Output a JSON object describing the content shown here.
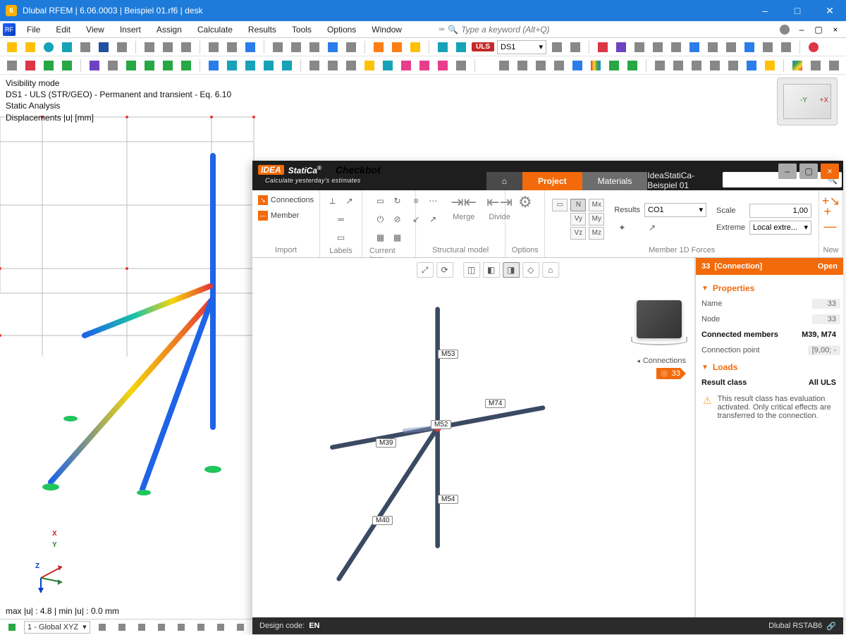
{
  "window": {
    "title": "Dlubal RFEM | 6.06.0003 | Beispiel 01.rf6 | desk"
  },
  "menubar": {
    "items": [
      "File",
      "Edit",
      "View",
      "Insert",
      "Assign",
      "Calculate",
      "Results",
      "Tools",
      "Options",
      "Window"
    ],
    "search_placeholder": "Type a keyword (Alt+Q)"
  },
  "uls": {
    "badge": "ULS",
    "combo": "DS1"
  },
  "rfem_overlay": {
    "l1": "Visibility mode",
    "l2": "DS1 - ULS (STR/GEO) - Permanent and transient - Eq. 6.10",
    "l3": "Static Analysis",
    "l4": "Displacements |u| [mm]",
    "bottom": "max |u| : 4.8 | min |u| : 0.0 mm"
  },
  "axes": {
    "x": "X",
    "y": "Y",
    "z": "Z",
    "plusx": "+X",
    "minusy": "-Y"
  },
  "statusbar": {
    "coord_system": "1 - Global XYZ"
  },
  "checkbot": {
    "brand_idea": "IDEA",
    "brand_statica": "StatiCa",
    "brand_reg": "®",
    "app_name": "Checkbot",
    "tagline": "Calculate yesterday's estimates",
    "project": "IdeaStatiCa-Beispiel 01",
    "tabs": {
      "project": "Project",
      "materials": "Materials"
    },
    "ribbon": {
      "import": {
        "connections": "Connections",
        "member": "Member",
        "caption": "Import"
      },
      "labels": {
        "caption": "Labels"
      },
      "current": {
        "caption": "Current item"
      },
      "struct": {
        "merge": "Merge",
        "divide": "Divide",
        "caption": "Structural model"
      },
      "options": {
        "caption": "Options"
      },
      "forces": {
        "N": "N",
        "Mx": "Mx",
        "Vy": "Vy",
        "My": "My",
        "Vz": "Vz",
        "Mz": "Mz",
        "results_lbl": "Results",
        "results_val": "CO1",
        "scale_lbl": "Scale",
        "scale_val": "1,00",
        "extreme_lbl": "Extreme",
        "extreme_val": "Local extre...",
        "caption": "Member 1D Forces"
      },
      "new": {
        "caption": "New"
      }
    },
    "view": {
      "connections_hdr": "Connections",
      "connection_id": "33",
      "members": {
        "m53": "M53",
        "m74": "M74",
        "m52": "M52",
        "m39": "M39",
        "m40": "M40",
        "m54": "M54"
      }
    },
    "props": {
      "hdr_id": "33",
      "hdr_type": "[Connection]",
      "hdr_open": "Open",
      "sec_properties": "Properties",
      "name_lbl": "Name",
      "name_val": "33",
      "node_lbl": "Node",
      "node_val": "33",
      "members_lbl": "Connected members",
      "members_val": "M39, M74",
      "connpt_lbl": "Connection point",
      "connpt_val": "[9,00; -",
      "sec_loads": "Loads",
      "resultclass_lbl": "Result class",
      "resultclass_val": "All ULS",
      "warn_text": "This result class has evaluation activated. Only critical effects are transferred to the connection."
    },
    "status": {
      "label": "Design code:",
      "value": "EN",
      "right": "Dlubal RSTAB6"
    }
  }
}
